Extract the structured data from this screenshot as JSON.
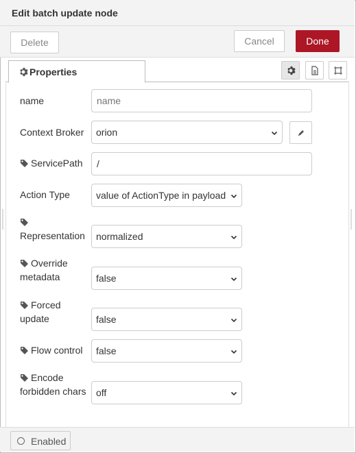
{
  "header": {
    "title": "Edit batch update node"
  },
  "toolbar": {
    "delete_label": "Delete",
    "cancel_label": "Cancel",
    "done_label": "Done"
  },
  "tabs": {
    "properties_label": "Properties"
  },
  "tab_buttons": [
    "gear-icon",
    "file-icon",
    "frame-icon"
  ],
  "form": {
    "name": {
      "label": "name",
      "placeholder": "name",
      "value": ""
    },
    "context_broker": {
      "label": "Context Broker",
      "value": "orion"
    },
    "service_path": {
      "label": "ServicePath",
      "value": "/"
    },
    "action_type": {
      "label": "Action Type",
      "value": "value of ActionType in payload"
    },
    "representation": {
      "label": "Representation",
      "value": "normalized"
    },
    "override_metadata": {
      "label_line1": "Override",
      "label_line2": "metadata",
      "value": "false"
    },
    "forced_update": {
      "label_line1": "Forced",
      "label_line2": "update",
      "value": "false"
    },
    "flow_control": {
      "label": "Flow control",
      "value": "false"
    },
    "encode_forbidden": {
      "label_line1": "Encode",
      "label_line2": "forbidden chars",
      "value": "off"
    }
  },
  "footer": {
    "enabled_label": "Enabled"
  },
  "colors": {
    "done_bg": "#ad1625",
    "header_bg": "#f3f3f3",
    "border": "#cccccc"
  }
}
